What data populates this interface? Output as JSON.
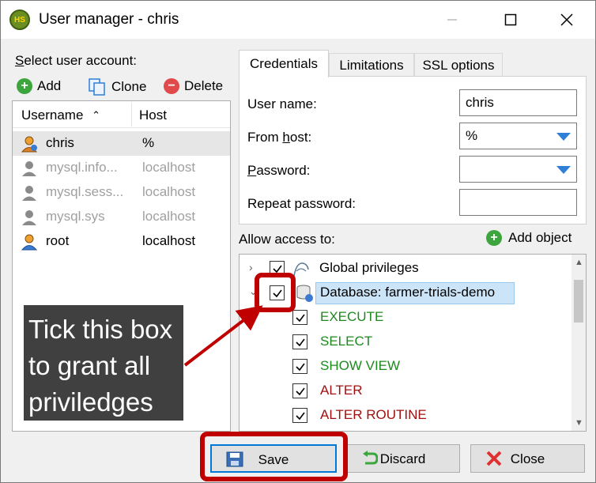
{
  "window": {
    "app_icon": "HS",
    "title": "User manager - chris",
    "min_icon": "minimize-icon",
    "max_icon": "maximize-icon",
    "close_icon": "close-icon"
  },
  "left": {
    "select_label_u": "S",
    "select_label_rest": "elect user account:",
    "toolbar": {
      "add": "Add",
      "clone": "Clone",
      "delete": "Delete"
    },
    "columns": {
      "username": "Username",
      "host": "Host",
      "sort_indicator": "^"
    },
    "users": [
      {
        "name": "chris",
        "host": "%",
        "selected": true,
        "enabled": true
      },
      {
        "name": "mysql.info...",
        "host": "localhost",
        "selected": false,
        "enabled": false
      },
      {
        "name": "mysql.sess...",
        "host": "localhost",
        "selected": false,
        "enabled": false
      },
      {
        "name": "mysql.sys",
        "host": "localhost",
        "selected": false,
        "enabled": false
      },
      {
        "name": "root",
        "host": "localhost",
        "selected": false,
        "enabled": true
      }
    ]
  },
  "tabs": [
    {
      "label": "Credentials",
      "active": true
    },
    {
      "label": "Limitations",
      "active": false
    },
    {
      "label": "SSL options",
      "active": false
    }
  ],
  "credentials": {
    "user_name_label": "User name:",
    "user_name_value": "chris",
    "from_host_label_pre": "From ",
    "from_host_label_u": "h",
    "from_host_label_post": "ost:",
    "from_host_value": "%",
    "password_label_u": "P",
    "password_label_rest": "assword:",
    "password_value": "",
    "repeat_password_label": "Repeat password:",
    "repeat_password_value": ""
  },
  "access": {
    "label": "Allow access to:",
    "add_object": "Add object",
    "tree": [
      {
        "label": "Global privileges",
        "checked": true,
        "level": 0,
        "expander": ">",
        "kind": "global"
      },
      {
        "label": "Database: farmer-trials-demo",
        "checked": true,
        "level": 0,
        "expander": "v",
        "kind": "database",
        "highlighted": true
      },
      {
        "label": "EXECUTE",
        "checked": true,
        "level": 1,
        "color": "green"
      },
      {
        "label": "SELECT",
        "checked": true,
        "level": 1,
        "color": "green"
      },
      {
        "label": "SHOW VIEW",
        "checked": true,
        "level": 1,
        "color": "green"
      },
      {
        "label": "ALTER",
        "checked": true,
        "level": 1,
        "color": "red"
      },
      {
        "label": "ALTER ROUTINE",
        "checked": true,
        "level": 1,
        "color": "red"
      }
    ]
  },
  "buttons": {
    "save": "Save",
    "discard": "Discard",
    "close": "Close"
  },
  "annotation": {
    "callout_text": "Tick this box to grant all priviledges",
    "highlight_color": "#c00000"
  }
}
